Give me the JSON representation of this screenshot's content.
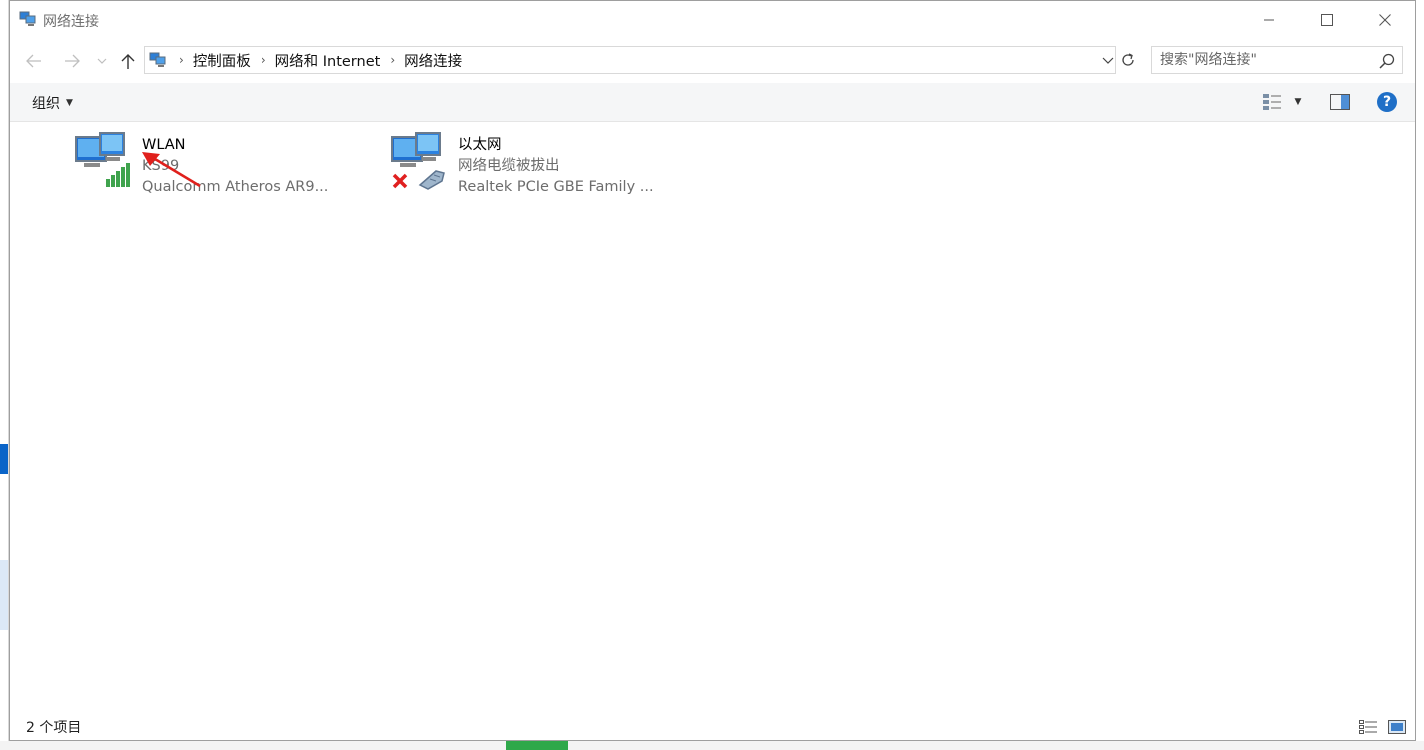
{
  "window": {
    "title": "网络连接",
    "controls": {
      "minimize": "—",
      "maximize": "□",
      "close": "✕"
    }
  },
  "navigation": {
    "breadcrumb": [
      "控制面板",
      "网络和 Internet",
      "网络连接"
    ],
    "separator": "›",
    "search_placeholder": "搜索\"网络连接\""
  },
  "toolbar": {
    "organize_label": "组织",
    "help_label": "?"
  },
  "connections": [
    {
      "name": "WLAN",
      "network": "KS99",
      "adapter": "Qualcomm Atheros AR9...",
      "icon": "wifi-signal-icon"
    },
    {
      "name": "以太网",
      "network": "网络电缆被拔出",
      "adapter": "Realtek PCIe GBE Family ...",
      "icon": "ethernet-disconnected-icon"
    }
  ],
  "status_bar": {
    "item_count": "2 个项目"
  },
  "colors": {
    "annotation_arrow": "#e0201c",
    "help_blue": "#1f6fc7",
    "signal_green": "#3fa34d",
    "error_red": "#e02020"
  }
}
